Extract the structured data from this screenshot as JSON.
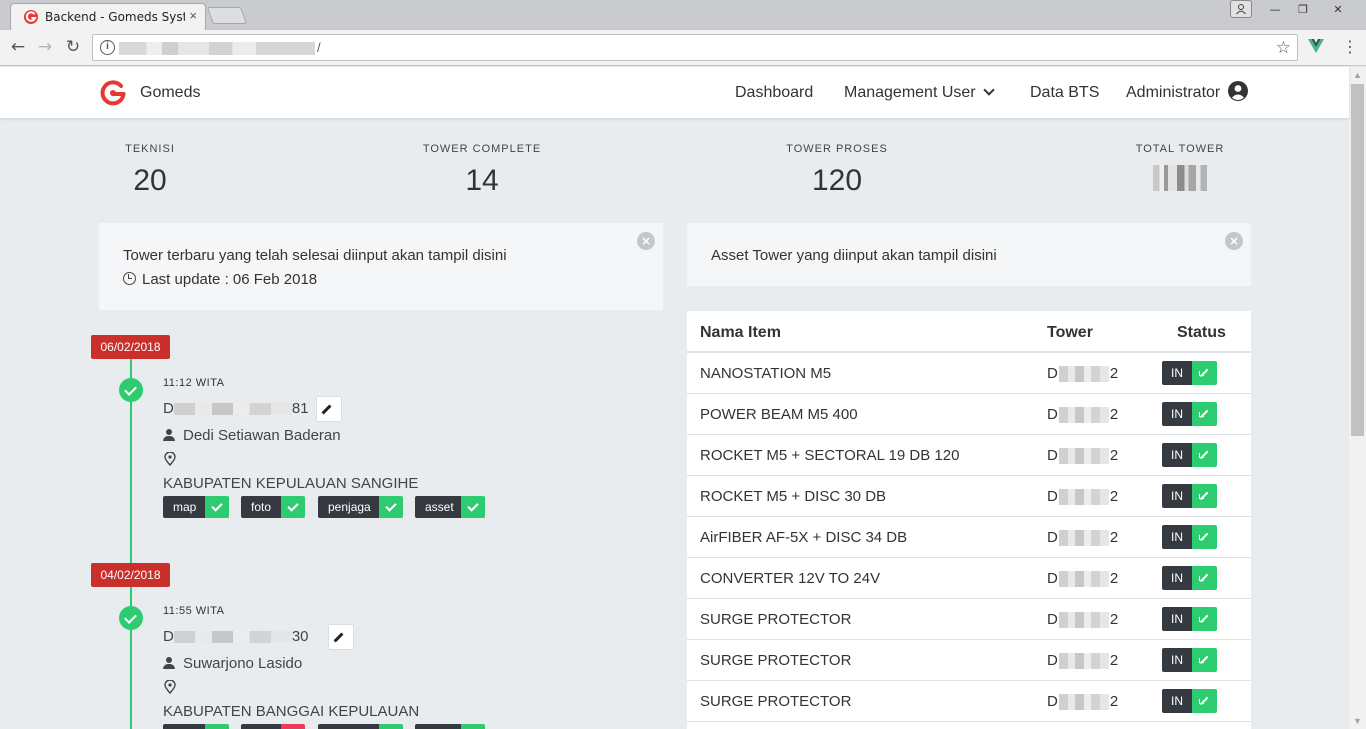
{
  "browser": {
    "tab_title": "Backend - Gomeds Syste",
    "tab_close": "×",
    "url_suffix": "/",
    "window_controls": {
      "minimize": "—",
      "restore": "❐",
      "close": "✕"
    }
  },
  "navbar": {
    "brand": "Gomeds",
    "links": [
      "Dashboard",
      "Management User",
      "Data BTS",
      "Administrator"
    ]
  },
  "stats": [
    {
      "label": "TEKNISI",
      "value": "20"
    },
    {
      "label": "TOWER COMPLETE",
      "value": "14"
    },
    {
      "label": "TOWER PROSES",
      "value": "120"
    },
    {
      "label": "TOTAL TOWER",
      "value": ""
    }
  ],
  "panels": {
    "left": {
      "text": "Tower terbaru yang telah selesai diinput akan tampil disini",
      "last_update": "Last update : 06 Feb 2018"
    },
    "right": {
      "text": "Asset Tower yang diinput akan tampil disini"
    },
    "close_glyph": "×"
  },
  "timeline": [
    {
      "date": "06/02/2018",
      "time": "11:12 WITA",
      "code_prefix": "D",
      "code_suffix": "81",
      "person": "Dedi Setiawan Baderan",
      "location": "KABUPATEN KEPULAUAN SANGIHE",
      "tags": [
        "map",
        "foto",
        "penjaga",
        "asset"
      ]
    },
    {
      "date": "04/02/2018",
      "time": "11:55 WITA",
      "code_prefix": "D",
      "code_suffix": "30",
      "person": "Suwarjono Lasido",
      "location": "KABUPATEN BANGGAI KEPULAUAN",
      "tags": [
        "",
        "",
        "",
        ""
      ]
    }
  ],
  "table": {
    "headers": [
      "Nama Item",
      "Tower",
      "Status"
    ],
    "rows": [
      {
        "item": "NANOSTATION M5",
        "tower_prefix": "D",
        "tower_suffix": "2",
        "status": "IN"
      },
      {
        "item": "POWER BEAM M5 400",
        "tower_prefix": "D",
        "tower_suffix": "2",
        "status": "IN"
      },
      {
        "item": "ROCKET M5 + SECTORAL 19 DB 120",
        "tower_prefix": "D",
        "tower_suffix": "2",
        "status": "IN"
      },
      {
        "item": "ROCKET M5 + DISC 30 DB",
        "tower_prefix": "D",
        "tower_suffix": "2",
        "status": "IN"
      },
      {
        "item": "AirFIBER AF-5X + DISC 34 DB",
        "tower_prefix": "D",
        "tower_suffix": "2",
        "status": "IN"
      },
      {
        "item": "CONVERTER 12V TO 24V",
        "tower_prefix": "D",
        "tower_suffix": "2",
        "status": "IN"
      },
      {
        "item": "SURGE PROTECTOR",
        "tower_prefix": "D",
        "tower_suffix": "2",
        "status": "IN"
      },
      {
        "item": "SURGE PROTECTOR",
        "tower_prefix": "D",
        "tower_suffix": "2",
        "status": "IN"
      },
      {
        "item": "SURGE PROTECTOR",
        "tower_prefix": "D",
        "tower_suffix": "2",
        "status": "IN"
      }
    ]
  },
  "colors": {
    "brand_red": "#e53935",
    "badge_red": "#c9302c",
    "success_green": "#2ecc71",
    "dark_chip": "#343a40"
  }
}
